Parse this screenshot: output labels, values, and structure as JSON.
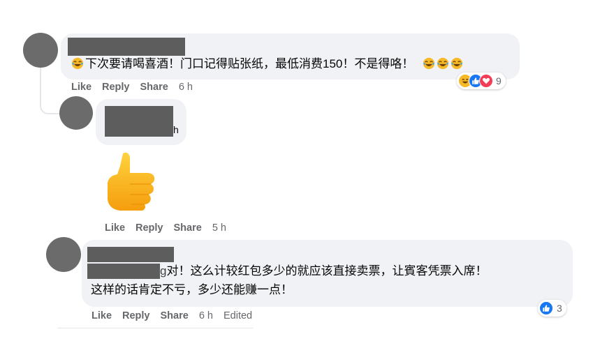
{
  "comments": [
    {
      "text": "下次要请喝喜酒！门口记得贴张纸，最低消费150！不是得咯！",
      "actions": {
        "like": "Like",
        "reply": "Reply",
        "share": "Share"
      },
      "time": "6 h",
      "reaction_count": "9",
      "reaction_icons": [
        "laugh-icon",
        "like-icon",
        "love-icon"
      ]
    },
    {
      "name_fragment": "h",
      "sticker": "thumbs-up-sticker",
      "actions": {
        "like": "Like",
        "reply": "Reply",
        "share": "Share"
      },
      "time": "5 h"
    },
    {
      "text_line1_fragment": "g",
      "text_line1": "对！这么计较红包多少的就应该直接卖票，让賓客凭票入席！",
      "text_line2": "这样的话肯定不亏，多少还能赚一点！",
      "actions": {
        "like": "Like",
        "reply": "Reply",
        "share": "Share"
      },
      "time": "6 h",
      "edited": "Edited",
      "reaction_count": "3",
      "reaction_icons": [
        "like-icon"
      ]
    }
  ],
  "colors": {
    "like_blue": "#1877f2",
    "love_red": "#f33e58",
    "laugh_yellow": "#f7b928",
    "bubble_bg": "#f0f2f5",
    "meta_gray": "#65676b"
  }
}
